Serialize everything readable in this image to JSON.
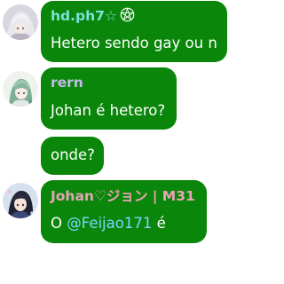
{
  "messages": [
    {
      "author": "hd.ph7",
      "author_suffix": "☆",
      "author_color": "#7fe0d8",
      "badge_icon": "pentagram-icon",
      "text": "Hetero sendo gay ou n",
      "avatar": "white-haired-anime-avatar"
    },
    {
      "author": "rern",
      "author_color": "#c6b8ea",
      "text": "Johan é hetero?",
      "avatar": "green-haired-anime-avatar"
    },
    {
      "text": "onde?"
    },
    {
      "author": "Johan♡ジョン | M31",
      "author_color": "#e9a3b8",
      "text_prefix": "O ",
      "mention": "@Feijao171",
      "text_suffix": " é",
      "mention_color": "#7fd3ff",
      "avatar": "dark-haired-anime-avatar"
    }
  ],
  "colors": {
    "bubble": "#0a870a",
    "text": "#ffffff"
  }
}
